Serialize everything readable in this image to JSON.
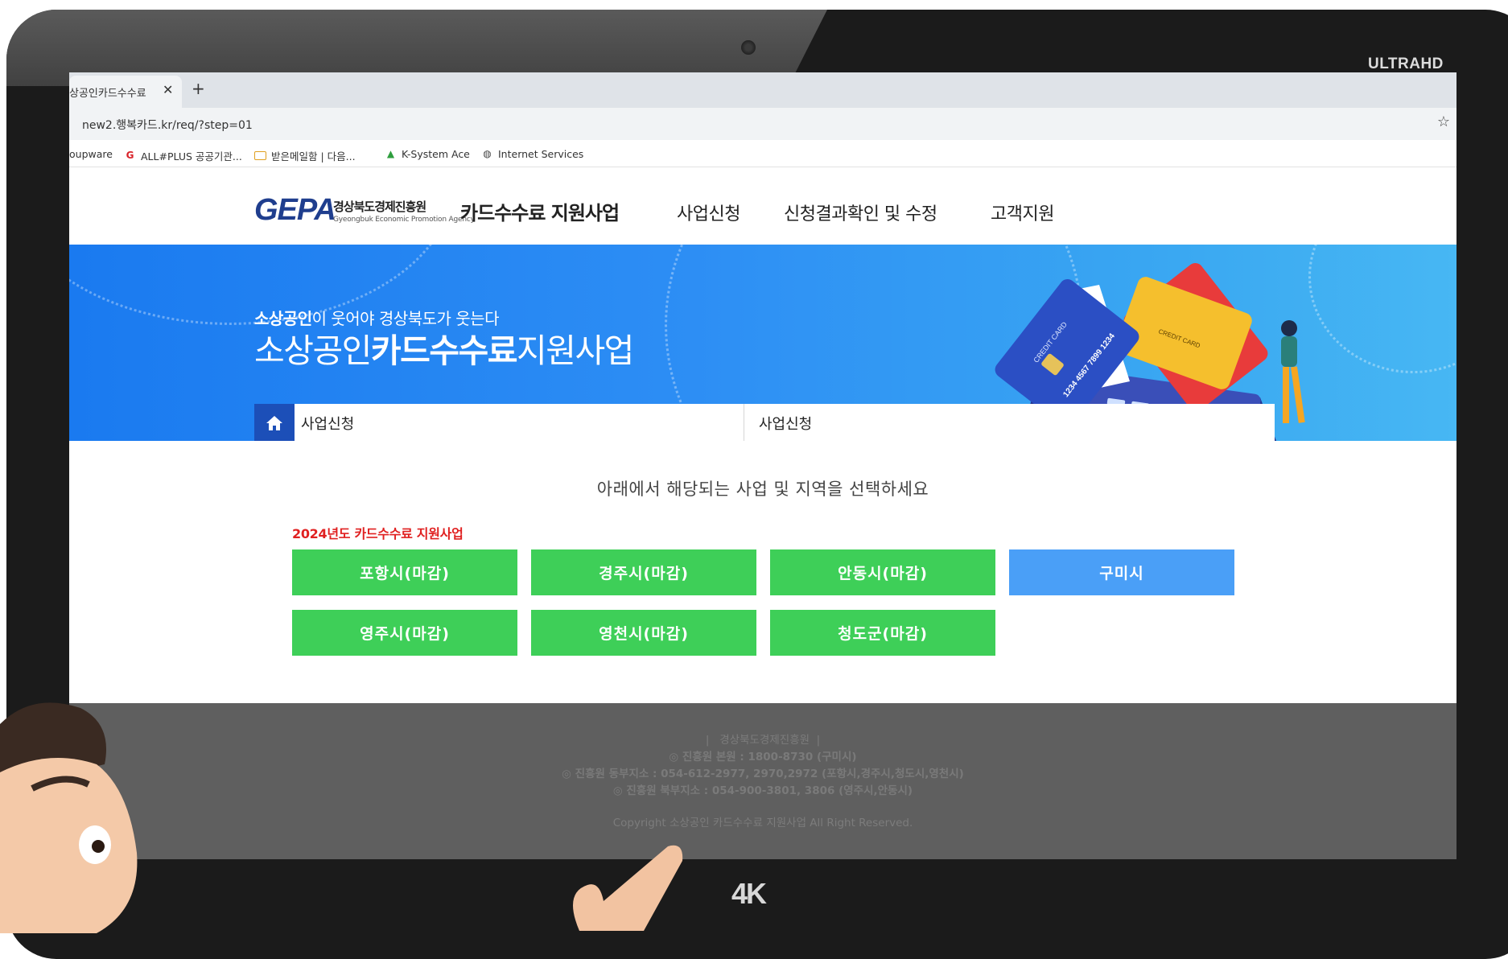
{
  "device": {
    "brand_text": "ULTRAHD",
    "badge_text": "4K"
  },
  "browser": {
    "tab": {
      "title": "상공인카드수수료",
      "close_glyph": "✕",
      "new_tab_glyph": "+"
    },
    "address": {
      "url": "new2.행복카드.kr/req/?step=01",
      "star_glyph": "☆"
    },
    "bookmarks": [
      {
        "label": "oupware",
        "icon": "none"
      },
      {
        "label": "ALL#PLUS 공공기관...",
        "icon": "allplus-icon"
      },
      {
        "label": "받은메일함 | 다음...",
        "icon": "mail-icon"
      },
      {
        "label": "K-System Ace",
        "icon": "ksystem-icon"
      },
      {
        "label": "Internet Services",
        "icon": "globe-icon"
      }
    ]
  },
  "header": {
    "logo_mark": "GEPA",
    "org_name": "경상북도경제진흥원",
    "org_name_en": "Gyeongbuk Economic Promotion Agency",
    "site_name": "카드수수료 지원사업",
    "nav": [
      "사업신청",
      "신청결과확인 및 수정",
      "고객지원"
    ]
  },
  "hero": {
    "subtitle_bold": "소상공인",
    "subtitle_rest": "이 웃어야 경상북도가 웃는다",
    "title_pre": "소상공인",
    "title_bold": "카드수수료",
    "title_post": "지원사업",
    "card_texts": [
      "CREDIT CARD",
      "1234 4567 7899 1234"
    ]
  },
  "breadcrumb": {
    "home_icon": "home-icon",
    "items": [
      "사업신청",
      "사업신청"
    ]
  },
  "main": {
    "instruction": "아래에서 해당되는 사업 및 지역을 선택하세요",
    "year_label": "2024년도 카드수수료 지원사업",
    "regions": [
      {
        "label": "포항시(마감)",
        "status": "closed"
      },
      {
        "label": "경주시(마감)",
        "status": "closed"
      },
      {
        "label": "안동시(마감)",
        "status": "closed"
      },
      {
        "label": "구미시",
        "status": "open"
      },
      {
        "label": "영주시(마감)",
        "status": "closed"
      },
      {
        "label": "영천시(마감)",
        "status": "closed"
      },
      {
        "label": "청도군(마감)",
        "status": "closed"
      }
    ],
    "colors": {
      "closed": "#3ecf58",
      "open": "#4a9ff7",
      "accent": "#e02020"
    }
  },
  "footer": {
    "org": "경상북도경제진흥원",
    "lines": [
      "◎ 진흥원 본원 : 1800-8730 (구미시)",
      "◎ 진흥원 동부지소 : 054-612-2977, 2970,2972 (포항시,경주시,청도시,영천시)",
      "◎ 진흥원 북부지소 : 054-900-3801, 3806 (영주시,안동시)"
    ],
    "copyright": "Copyright 소상공인 카드수수료 지원사업 All Right Reserved."
  }
}
